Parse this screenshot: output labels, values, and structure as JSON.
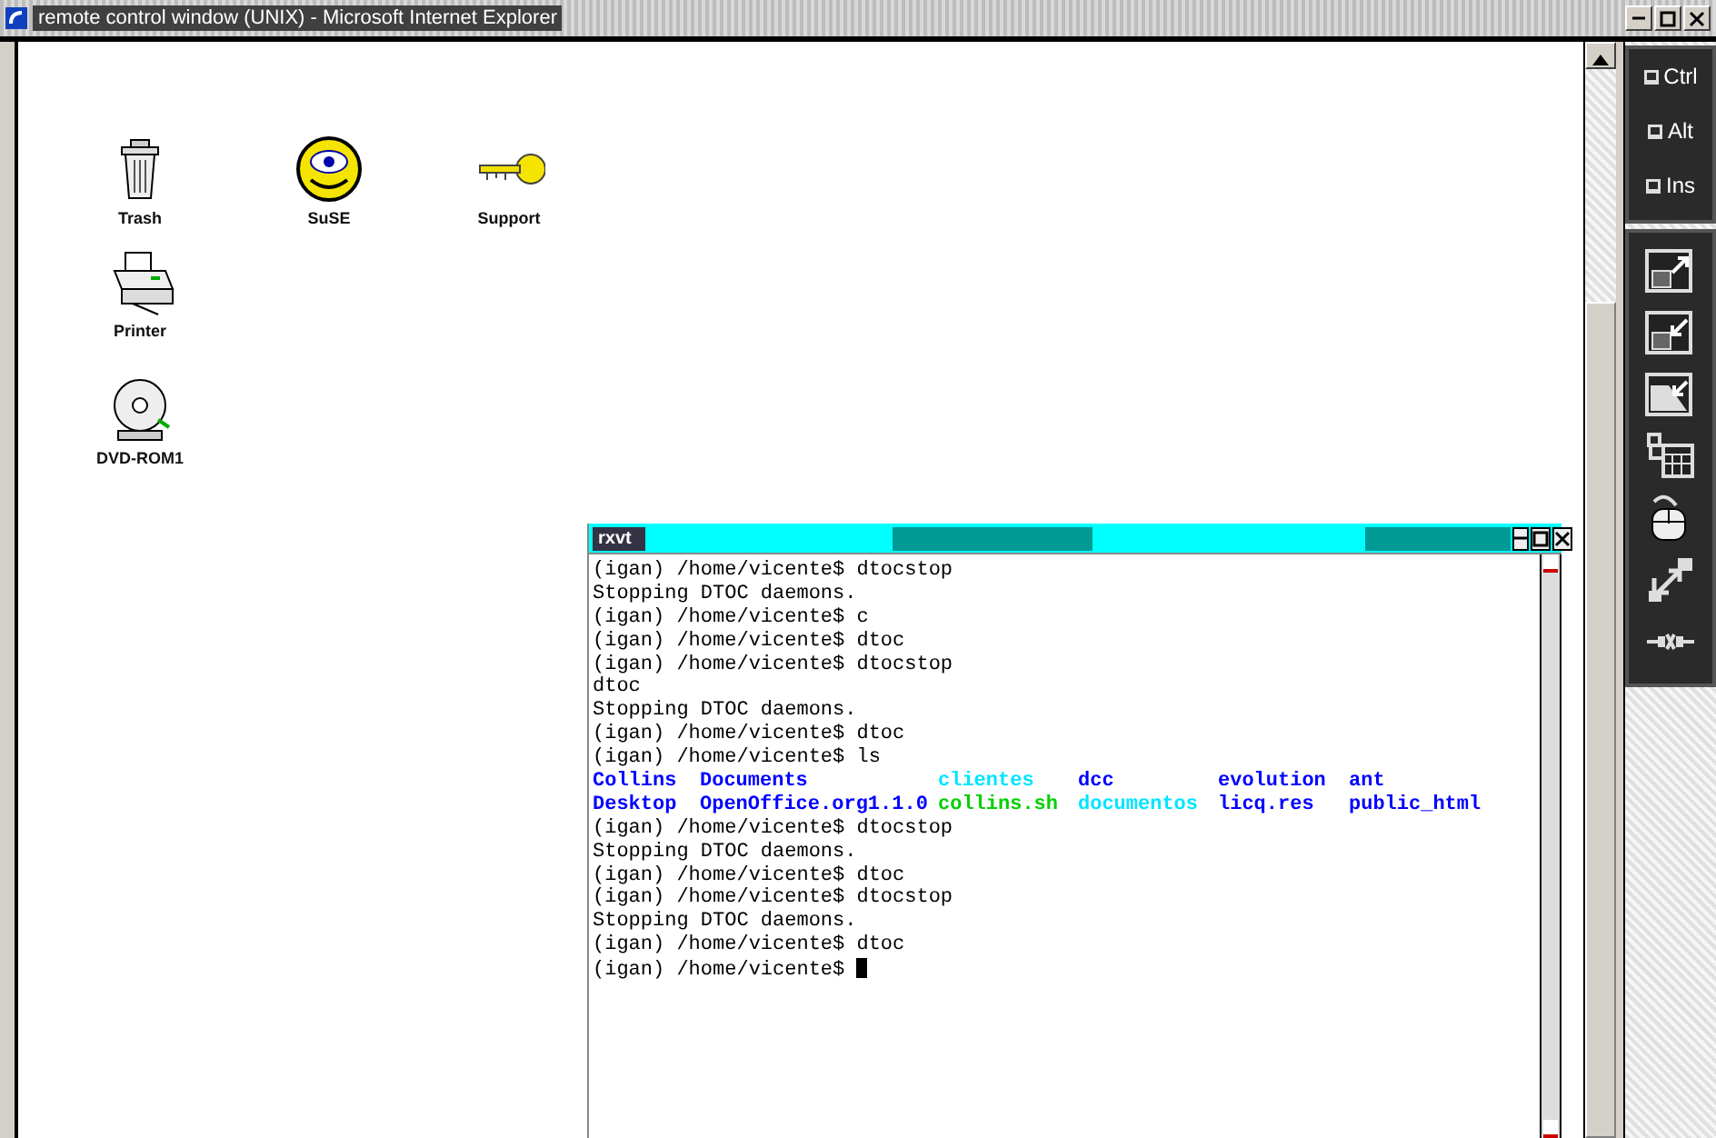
{
  "window": {
    "title": "remote control window (UNIX) - Microsoft Internet Explorer"
  },
  "desktop_icons": [
    {
      "label": "Trash",
      "kind": "trash"
    },
    {
      "label": "SuSE",
      "kind": "emblem"
    },
    {
      "label": "Support",
      "kind": "key"
    },
    {
      "label": "Printer",
      "kind": "printer"
    },
    {
      "label": "DVD-ROM1",
      "kind": "disc"
    }
  ],
  "terminal": {
    "title": "rxvt",
    "lines": [
      {
        "kind": "plain",
        "text": "(igan) /home/vicente$ dtocstop"
      },
      {
        "kind": "plain",
        "text": "Stopping DTOC daemons."
      },
      {
        "kind": "plain",
        "text": "(igan) /home/vicente$ c"
      },
      {
        "kind": "plain",
        "text": "(igan) /home/vicente$ dtoc"
      },
      {
        "kind": "plain",
        "text": "(igan) /home/vicente$ dtocstop"
      },
      {
        "kind": "plain",
        "text": "dtoc"
      },
      {
        "kind": "plain",
        "text": "Stopping DTOC daemons."
      },
      {
        "kind": "plain",
        "text": "(igan) /home/vicente$ dtoc"
      },
      {
        "kind": "plain",
        "text": "(igan) /home/vicente$ ls"
      },
      {
        "kind": "files",
        "files": [
          {
            "name": "Collins",
            "color": "#0000ff"
          },
          {
            "name": "Documents",
            "color": "#0000ff"
          },
          {
            "name": "clientes",
            "color": "#00e5ff"
          },
          {
            "name": "dcc",
            "color": "#0000ff"
          },
          {
            "name": "evolution",
            "color": "#0000ff"
          },
          {
            "name": "ant",
            "color": "#0000ff"
          }
        ]
      },
      {
        "kind": "files",
        "files": [
          {
            "name": "Desktop",
            "color": "#0000ff"
          },
          {
            "name": "OpenOffice.org1.1.0",
            "color": "#0000ff"
          },
          {
            "name": "collins.sh",
            "color": "#00d000"
          },
          {
            "name": "documentos",
            "color": "#00e5ff"
          },
          {
            "name": "licq.res",
            "color": "#0000ff"
          },
          {
            "name": "public_html",
            "color": "#0000ff"
          }
        ]
      },
      {
        "kind": "plain",
        "text": "(igan) /home/vicente$ dtocstop"
      },
      {
        "kind": "plain",
        "text": "Stopping DTOC daemons."
      },
      {
        "kind": "plain",
        "text": "(igan) /home/vicente$ dtoc"
      },
      {
        "kind": "plain",
        "text": "(igan) /home/vicente$ dtocstop"
      },
      {
        "kind": "plain",
        "text": "Stopping DTOC daemons."
      },
      {
        "kind": "plain",
        "text": "(igan) /home/vicente$ dtoc"
      },
      {
        "kind": "prompt",
        "text": "(igan) /home/vicente$"
      }
    ]
  },
  "side_panel": {
    "keys": [
      {
        "label": "Ctrl"
      },
      {
        "label": "Alt"
      },
      {
        "label": "Ins"
      }
    ],
    "tools": [
      {
        "kind": "window-up"
      },
      {
        "kind": "window-down"
      },
      {
        "kind": "resize"
      },
      {
        "kind": "grid"
      },
      {
        "kind": "mouse"
      },
      {
        "kind": "swap"
      },
      {
        "kind": "disconnect"
      }
    ]
  }
}
